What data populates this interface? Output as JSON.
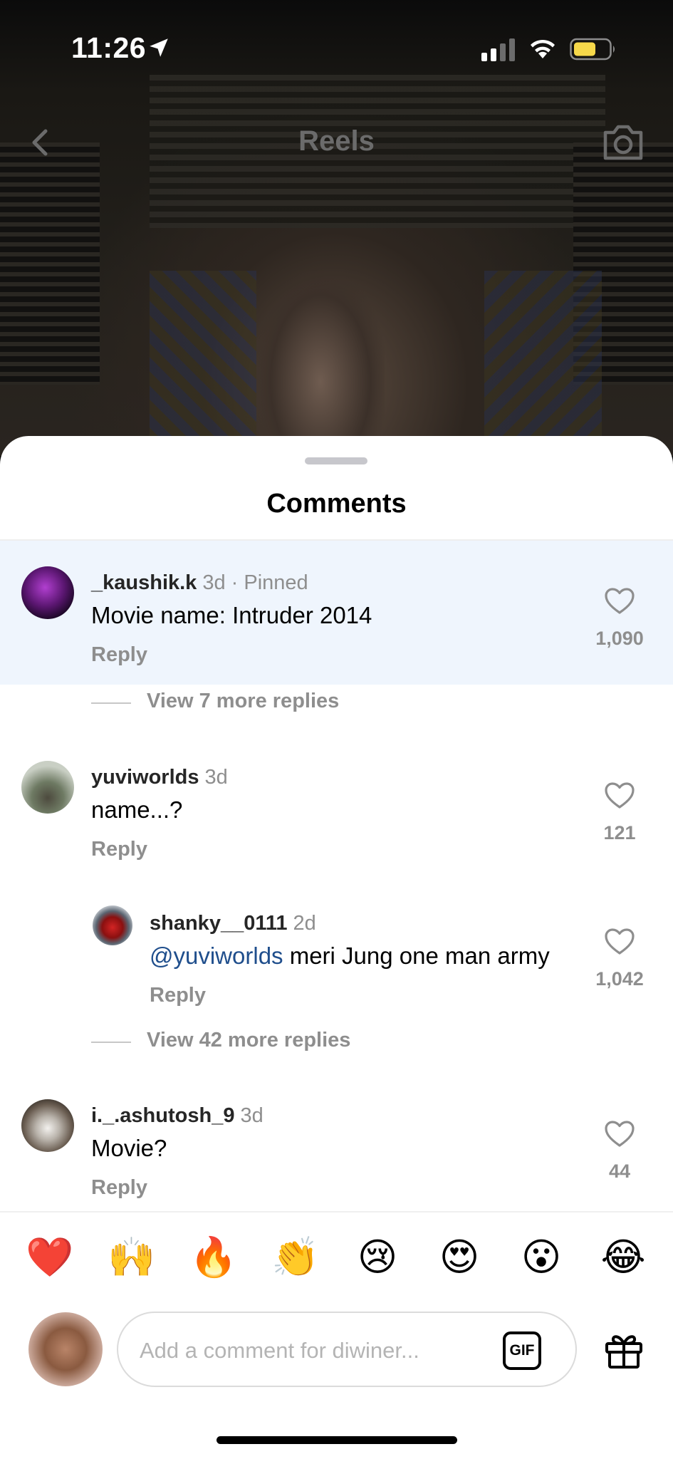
{
  "status_bar": {
    "time": "11:26"
  },
  "header": {
    "title": "Reels"
  },
  "sheet": {
    "title": "Comments"
  },
  "comments": [
    {
      "username": "_kaushik.k",
      "meta": "3d · Pinned",
      "text": "Movie name: Intruder 2014",
      "reply_label": "Reply",
      "likes": "1,090",
      "more_replies": "View 7 more replies"
    },
    {
      "username": "yuviworlds",
      "meta": "3d",
      "text": "name...?",
      "reply_label": "Reply",
      "likes": "121"
    },
    {
      "username": "shanky__0111",
      "meta": "2d",
      "mention": "@yuviworlds",
      "text": " meri Jung one man army",
      "reply_label": "Reply",
      "likes": "1,042",
      "more_replies": "View 42 more replies"
    },
    {
      "username": "i._.ashutosh_9",
      "meta": "3d",
      "text": "Movie?",
      "reply_label": "Reply",
      "likes": "44"
    }
  ],
  "emoji_reactions": [
    "❤️",
    "🙌",
    "🔥",
    "👏",
    "😢",
    "😍",
    "😮",
    "😂"
  ],
  "composer": {
    "placeholder": "Add a comment for diwiner...",
    "gif_label": "GIF"
  },
  "icons": {
    "location": "location-arrow-icon",
    "signal": "cellular-signal-icon",
    "wifi": "wifi-icon",
    "battery": "battery-icon",
    "back": "chevron-left-icon",
    "camera": "camera-icon",
    "heart": "heart-outline-icon",
    "gift": "gift-icon"
  },
  "colors": {
    "pinned_background": "#eff5fd",
    "mention": "#1f4e8c",
    "battery_fill": "#f6d84a",
    "secondary_text": "#8e8e8e"
  }
}
